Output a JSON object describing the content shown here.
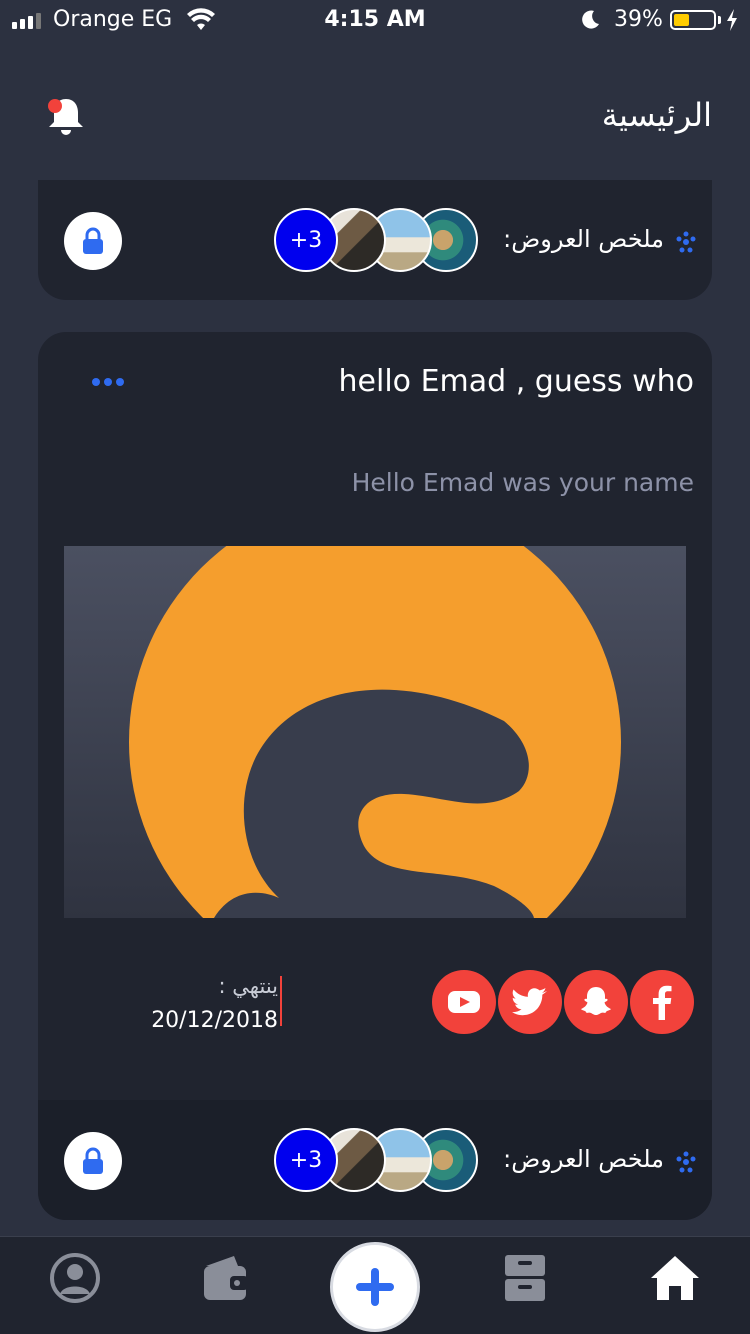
{
  "status_bar": {
    "carrier": "Orange EG",
    "time": "4:15 AM",
    "battery": "39%",
    "battery_level": 0.39
  },
  "header": {
    "title": "الرئيسية",
    "notification_icon": "bell-icon"
  },
  "top_card": {
    "summary_label": "ملخص العروض:",
    "more_count": "+3",
    "lock_icon": "lock-icon"
  },
  "post": {
    "title": "hello Emad , guess who",
    "description": "Hello Emad was your name",
    "more_icon": "ellipsis-icon",
    "expires_label": "ينتهي :",
    "expires_date": "20/12/2018",
    "social_icons": [
      "youtube-icon",
      "twitter-icon",
      "snapchat-icon",
      "facebook-icon"
    ],
    "footer_summary_label": "ملخص العروض:",
    "footer_more_count": "+3"
  },
  "tabbar": {
    "items": [
      "profile-icon",
      "wallet-icon",
      "add-icon",
      "archive-icon",
      "home-icon"
    ]
  },
  "colors": {
    "background": "#2c3140",
    "card": "#20242f",
    "accent_blue": "#2f6bf0",
    "social_red": "#f2423b",
    "brand_orange": "#f59e2d"
  }
}
